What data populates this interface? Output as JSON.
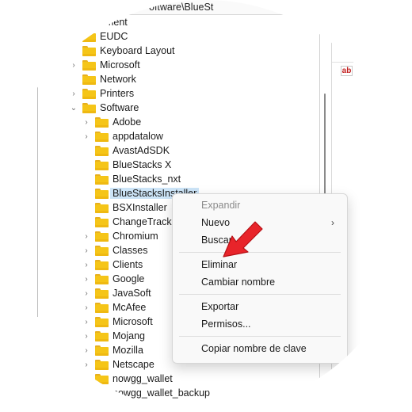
{
  "address_bar": {
    "text": "oftware\\BlueSt"
  },
  "right_pane": {
    "value_icon": "ab"
  },
  "tree": {
    "top_items": [
      {
        "label": "nment",
        "chevron": "",
        "partial": true
      },
      {
        "label": "EUDC",
        "chevron": ""
      },
      {
        "label": "Keyboard Layout",
        "chevron": ""
      },
      {
        "label": "Microsoft",
        "chevron": "›"
      },
      {
        "label": "Network",
        "chevron": ""
      },
      {
        "label": "Printers",
        "chevron": "›"
      },
      {
        "label": "Software",
        "chevron": "⌄"
      }
    ],
    "software_children": [
      {
        "label": "Adobe",
        "chevron": "›"
      },
      {
        "label": "appdatalow",
        "chevron": "›"
      },
      {
        "label": "AvastAdSDK",
        "chevron": ""
      },
      {
        "label": "BlueStacks X",
        "chevron": ""
      },
      {
        "label": "BlueStacks_nxt",
        "chevron": ""
      },
      {
        "label": "BlueStacksInstaller",
        "chevron": "",
        "selected": true
      },
      {
        "label": "BSXInstaller",
        "chevron": ""
      },
      {
        "label": "ChangeTracker",
        "chevron": ""
      },
      {
        "label": "Chromium",
        "chevron": "›"
      },
      {
        "label": "Classes",
        "chevron": "›"
      },
      {
        "label": "Clients",
        "chevron": "›"
      },
      {
        "label": "Google",
        "chevron": "›"
      },
      {
        "label": "JavaSoft",
        "chevron": "›"
      },
      {
        "label": "McAfee",
        "chevron": "›"
      },
      {
        "label": "Microsoft",
        "chevron": "›"
      },
      {
        "label": "Mojang",
        "chevron": "›"
      },
      {
        "label": "Mozilla",
        "chevron": "›"
      },
      {
        "label": "Netscape",
        "chevron": "›"
      },
      {
        "label": "nowgg_wallet",
        "chevron": ""
      },
      {
        "label": "nowgg_wallet_backup",
        "chevron": ""
      }
    ]
  },
  "context_menu": {
    "expandir": "Expandir",
    "nuevo": "Nuevo",
    "nuevo_arrow": "›",
    "buscar": "Buscar...",
    "eliminar": "Eliminar",
    "cambiar_nombre": "Cambiar nombre",
    "exportar": "Exportar",
    "permisos": "Permisos...",
    "copiar": "Copiar nombre de clave"
  },
  "colors": {
    "folder": "#f5c518",
    "selection": "#cce4f7",
    "arrow": "#e8242a"
  }
}
